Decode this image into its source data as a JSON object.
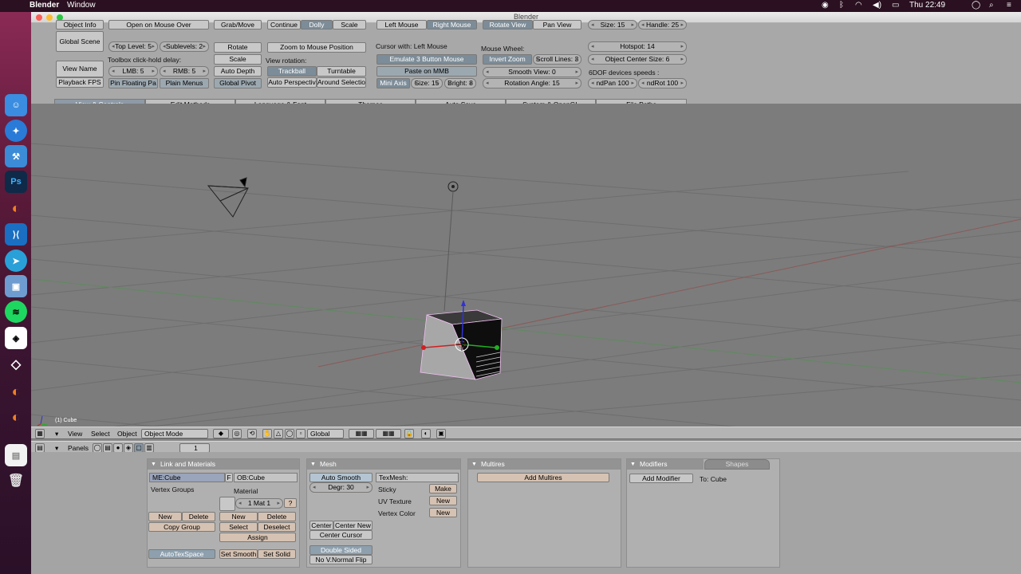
{
  "menubar": {
    "app_name": "Blender",
    "window_menu": "Window",
    "clock": "Thu 22:49"
  },
  "dock": {
    "icons": [
      "finder-icon",
      "safari-icon",
      "xcode-icon",
      "photoshop-icon",
      "blender-icon",
      "vscode-icon",
      "telegram-icon",
      "preview-icon",
      "spotify-icon",
      "unity-icon",
      "unity-hub-icon",
      "blender-icon",
      "blender-icon",
      "document-icon",
      "trash-icon"
    ]
  },
  "window": {
    "title": "Blender"
  },
  "prefs": {
    "col1": {
      "object_info": "Object Info",
      "global_scene": "Global Scene",
      "view_name": "View Name",
      "playback_fps": "Playback FPS"
    },
    "col2": {
      "open_on_mouse_over": "Open on Mouse Over",
      "top_level": "Top Level: 5",
      "sublevels": "Sublevels: 2",
      "toolbox_delay_label": "Toolbox click-hold delay:",
      "lmb": "LMB: 5",
      "rmb": "RMB: 5",
      "pin_floating": "Pin Floating Pa",
      "plain_menus": "Plain Menus"
    },
    "col3": {
      "grab_move": "Grab/Move",
      "rotate": "Rotate",
      "scale": "Scale",
      "auto_depth": "Auto Depth",
      "global_pivot": "Global Pivot"
    },
    "col4": {
      "continue": "Continue",
      "dolly": "Dolly",
      "scale": "Scale",
      "zoom_to_mouse": "Zoom to Mouse Position",
      "view_rotation_label": "View rotation:",
      "trackball": "Trackball",
      "turntable": "Turntable",
      "auto_perspective": "Auto Perspectiv",
      "around_selection": "Around Selectio"
    },
    "col5": {
      "left_mouse": "Left Mouse",
      "right_mouse": "Right Mouse",
      "cursor_with": "Cursor with: Left Mouse",
      "emulate_3_button": "Emulate 3 Button Mouse",
      "paste_on_mmb": "Paste on MMB",
      "mini_axis": "Mini Axis",
      "size": "Size: 15",
      "bright": "Bright: 8"
    },
    "col6": {
      "rotate_view": "Rotate View",
      "pan_view": "Pan View",
      "mouse_wheel_label": "Mouse Wheel:",
      "invert_zoom": "Invert Zoom",
      "scroll_lines": "Scroll Lines: 3",
      "smooth_view": "Smooth View: 0",
      "rotation_angle": "Rotation Angle: 15"
    },
    "col7": {
      "size": "Size: 15",
      "handle": "Handle: 25",
      "hotspot": "Hotspot: 14",
      "object_center_size": "Object Center Size: 6",
      "ndof_label": "6DOF devices speeds :",
      "ndpan": "ndPan 100",
      "ndrot": "ndRot 100"
    },
    "tabs": [
      "View & Controls",
      "Edit Methods",
      "Language & Font",
      "Themes",
      "Auto Save",
      "System & OpenGL",
      "File Paths"
    ]
  },
  "viewport": {
    "object_label": "(1) Cube"
  },
  "header3d": {
    "view": "View",
    "select": "Select",
    "object": "Object",
    "mode": "Object Mode",
    "orientation": "Global"
  },
  "buttons_header": {
    "panels": "Panels",
    "frame": "1"
  },
  "link_materials": {
    "title": "Link and Materials",
    "me_field": "ME:Cube",
    "f_btn": "F",
    "ob_field": "OB:Cube",
    "vertex_groups": "Vertex Groups",
    "material_label": "Material",
    "mat_field": "1 Mat 1",
    "help": "?",
    "vg_new": "New",
    "vg_delete": "Delete",
    "copy_group": "Copy Group",
    "mat_new": "New",
    "mat_delete": "Delete",
    "mat_select": "Select",
    "mat_deselect": "Deselect",
    "assign": "Assign",
    "autotexspace": "AutoTexSpace",
    "set_smooth": "Set Smooth",
    "set_solid": "Set Solid"
  },
  "mesh": {
    "title": "Mesh",
    "auto_smooth": "Auto Smooth",
    "degr": "Degr: 30",
    "texmesh": "TexMesh:",
    "sticky": "Sticky",
    "make": "Make",
    "uv_texture": "UV Texture",
    "uv_new": "New",
    "vertex_color": "Vertex Color",
    "vc_new": "New",
    "center": "Center",
    "center_new": "Center New",
    "center_cursor": "Center Cursor",
    "double_sided": "Double Sided",
    "no_v_normal_flip": "No V.Normal Flip"
  },
  "multires": {
    "title": "Multires",
    "add_multires": "Add Multires"
  },
  "modifiers": {
    "tab_modifiers": "Modifiers",
    "tab_shapes": "Shapes",
    "add_modifier": "Add Modifier",
    "to_label": "To: Cube"
  }
}
